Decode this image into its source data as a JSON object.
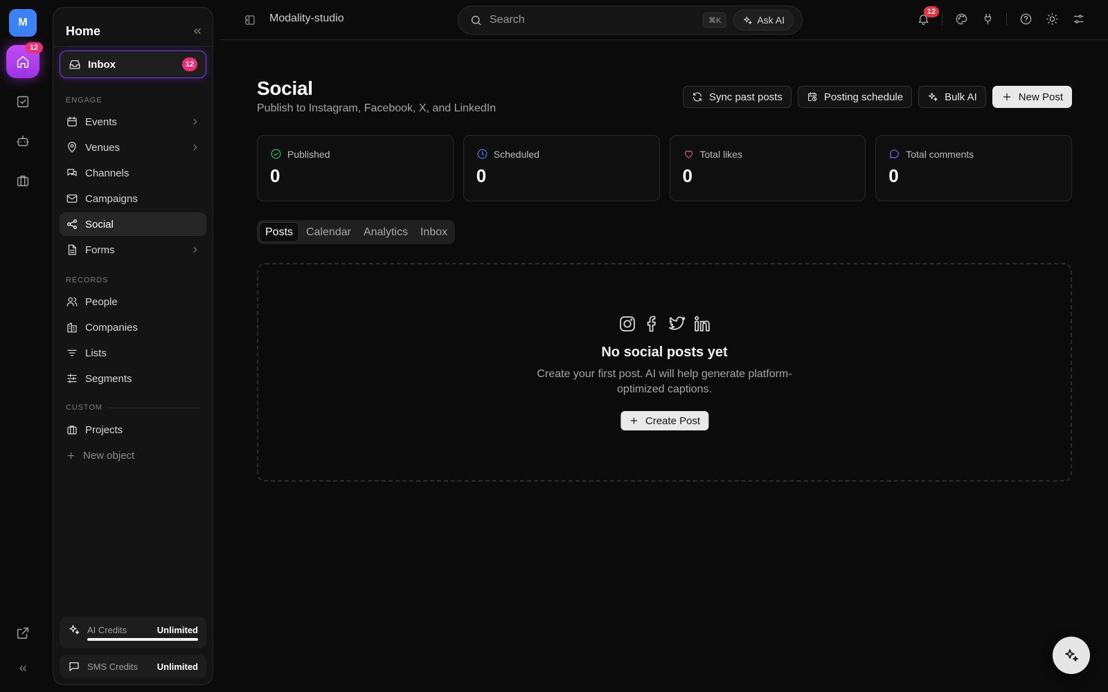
{
  "rail": {
    "workspace_initial": "M",
    "home_badge": "12"
  },
  "sidebar": {
    "title": "Home",
    "inbox": {
      "label": "Inbox",
      "badge": "12"
    },
    "sections": {
      "engage": "ENGAGE",
      "records": "RECORDS",
      "custom": "CUSTOM"
    },
    "engage_items": [
      "Events",
      "Venues",
      "Channels",
      "Campaigns",
      "Social",
      "Forms"
    ],
    "record_items": [
      "People",
      "Companies",
      "Lists",
      "Segments"
    ],
    "custom_items": [
      "Projects"
    ],
    "new_object": "New object",
    "credits": [
      {
        "name": "AI Credits",
        "value": "Unlimited",
        "fill": 1.0
      },
      {
        "name": "SMS Credits",
        "value": "Unlimited"
      }
    ]
  },
  "topbar": {
    "workspace": "Modality-studio",
    "search_placeholder": "Search",
    "shortcut": "⌘K",
    "ask_ai": "Ask AI",
    "notification_count": "12"
  },
  "page": {
    "title": "Social",
    "subtitle": "Publish to Instagram, Facebook, X, and LinkedIn",
    "actions": {
      "sync": "Sync past posts",
      "schedule": "Posting schedule",
      "bulk_ai": "Bulk AI",
      "new_post": "New Post"
    },
    "stats": [
      {
        "label": "Published",
        "value": "0",
        "icon": "check-circle-icon",
        "color": "#22c55e"
      },
      {
        "label": "Scheduled",
        "value": "0",
        "icon": "clock-icon",
        "color": "#3b82f6"
      },
      {
        "label": "Total likes",
        "value": "0",
        "icon": "heart-icon",
        "color": "#ec4899"
      },
      {
        "label": "Total comments",
        "value": "0",
        "icon": "comment-icon",
        "color": "#8b5cf6"
      }
    ],
    "tabs": [
      "Posts",
      "Calendar",
      "Analytics",
      "Inbox"
    ],
    "active_tab": "Posts",
    "empty": {
      "title": "No social posts yet",
      "description": "Create your first post. AI will help generate platform-optimized captions.",
      "button": "Create Post"
    }
  }
}
